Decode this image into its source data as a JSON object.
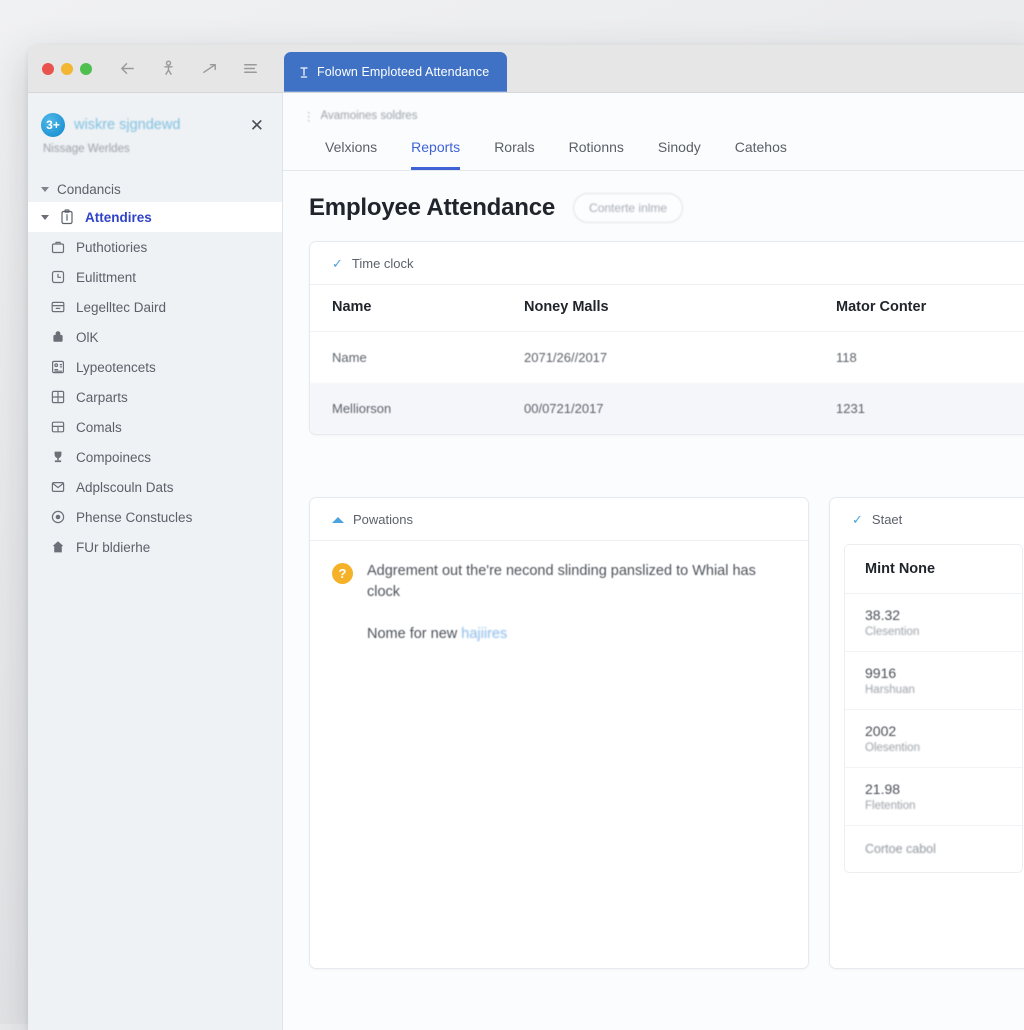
{
  "browser": {
    "tab_title": "Folown Emploteed Attendance",
    "nav_icons": [
      "back-arrow-icon",
      "person-icon",
      "forward-arrow-icon",
      "hamburger-menu-icon"
    ],
    "traffic_lights": [
      "close",
      "minimize",
      "maximize"
    ]
  },
  "sidebar": {
    "logo_glyph": "3+",
    "title": "wiskre sjgndewd",
    "subtitle": "Nissage Werldes",
    "close_label": "✕",
    "group_label": "Condancis",
    "items": [
      {
        "label": "Attendires",
        "icon": "clipboard-info-icon",
        "active": true,
        "expandable": true
      },
      {
        "label": "Puthotiories",
        "icon": "briefcase-icon",
        "active": false,
        "expandable": false
      },
      {
        "label": "Eulittment",
        "icon": "clock-square-icon",
        "active": false,
        "expandable": false
      },
      {
        "label": "Legelltec Daird",
        "icon": "archive-box-icon",
        "active": false,
        "expandable": false
      },
      {
        "label": "OlK",
        "icon": "lock-solid-icon",
        "active": false,
        "expandable": false
      },
      {
        "label": "Lypeotencets",
        "icon": "id-card-icon",
        "active": false,
        "expandable": false
      },
      {
        "label": "Carparts",
        "icon": "grid-blocks-icon",
        "active": false,
        "expandable": false
      },
      {
        "label": "Comals",
        "icon": "window-split-icon",
        "active": false,
        "expandable": false
      },
      {
        "label": "Compoinecs",
        "icon": "trophy-icon",
        "active": false,
        "expandable": false
      },
      {
        "label": "Adplscouln Dats",
        "icon": "envelope-icon",
        "active": false,
        "expandable": false
      },
      {
        "label": "Phense Constucles",
        "icon": "radio-dot-icon",
        "active": false,
        "expandable": false
      },
      {
        "label": "FUr bldierhe",
        "icon": "home-solid-icon",
        "active": false,
        "expandable": false
      }
    ]
  },
  "main": {
    "breadcrumb": "Avamoines soldres",
    "tabs": [
      {
        "label": "Velxions",
        "active": false
      },
      {
        "label": "Reports",
        "active": true
      },
      {
        "label": "Rorals",
        "active": false
      },
      {
        "label": "Rotionns",
        "active": false
      },
      {
        "label": "Sinody",
        "active": false
      },
      {
        "label": "Catehos",
        "active": false
      }
    ],
    "page_title": "Employee Attendance",
    "pill_label": "Conterte inlme"
  },
  "table_card": {
    "header_label": "Time clock",
    "header_icon": "check-icon",
    "columns": [
      "Name",
      "Noney Malls",
      "Mator Conter"
    ],
    "rows": [
      {
        "name": "Name",
        "date": "2071/26//2017",
        "value": "118"
      },
      {
        "name": "Melliorson",
        "date": "00/0721/2017",
        "value": "1231"
      }
    ]
  },
  "panel_left": {
    "header_label": "Powations",
    "header_icon": "chevron-up-icon",
    "badge_glyph": "?",
    "notice_text": "Adgrement out the're necond slinding panslized to Whial has clock",
    "sub_prefix": "Nome for new ",
    "sub_link": "hajiires"
  },
  "panel_right": {
    "header_label": "Staet",
    "header_icon": "check-icon",
    "list_title": "Mint None",
    "rows": [
      {
        "value": "38.32",
        "label": "Clesention"
      },
      {
        "value": "9916",
        "label": "Harshuan"
      },
      {
        "value": "2002",
        "label": "Olesention"
      },
      {
        "value": "21.98",
        "label": "Fletention"
      }
    ],
    "footer_label": "Cortoe cabol"
  },
  "colors": {
    "accent_blue": "#3f63d6",
    "tab_blue": "#3f72c4",
    "link_blue": "#87b8e8",
    "check_blue": "#4aa3e0",
    "badge_amber": "#f5b228",
    "sidebar_bg": "#eff2f5",
    "active_nav": "#2f43c9"
  }
}
